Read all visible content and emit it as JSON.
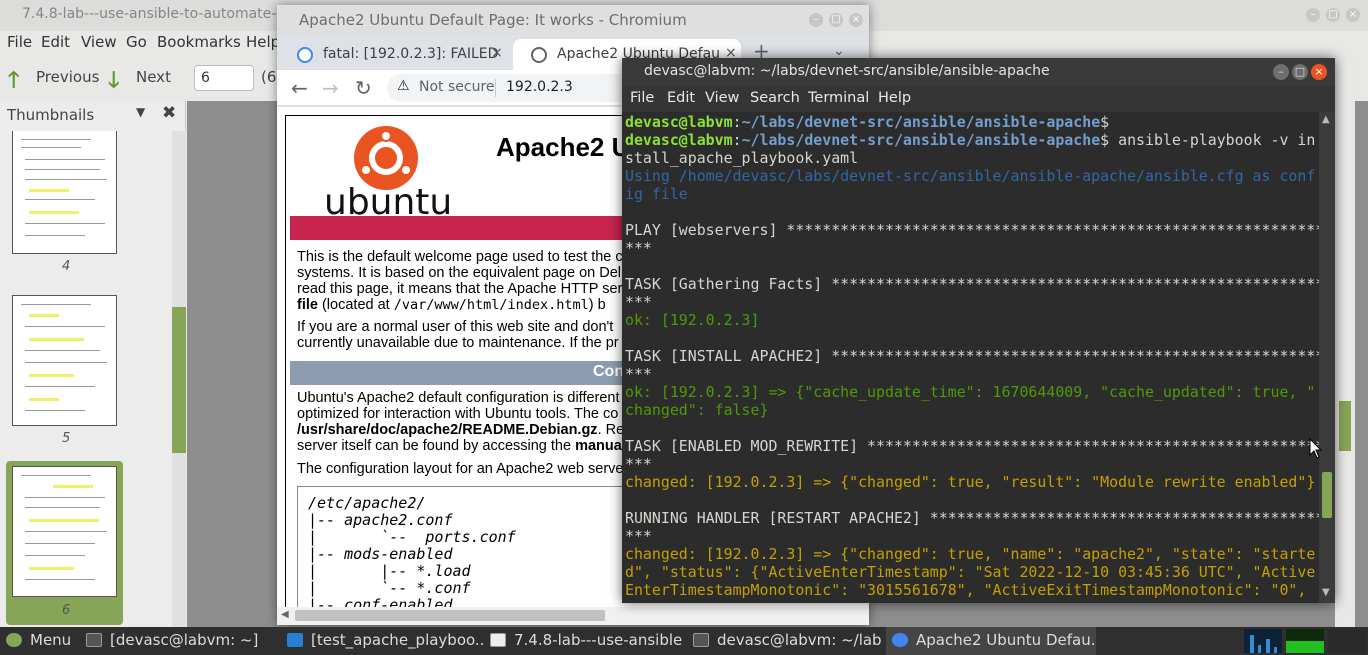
{
  "pdf_viewer": {
    "title": "7.4.8-lab---use-ansible-to-automate-in",
    "menu": [
      "File",
      "Edit",
      "View",
      "Go",
      "Bookmarks",
      "Help"
    ],
    "toolbar": {
      "previous": "Previous",
      "next": "Next",
      "page_value": "6",
      "page_total": "(6"
    },
    "sidebar": {
      "title": "Thumbnails",
      "page_labels": [
        "4",
        "5",
        "6"
      ]
    }
  },
  "browser": {
    "title": "Apache2 Ubuntu Default Page: It works - Chromium",
    "tabs": [
      {
        "label": "fatal: [192.0.2.3]: FAILED"
      },
      {
        "label": "Apache2 Ubuntu Defau"
      }
    ],
    "new_tab": "+",
    "address": {
      "security": "Not secure",
      "url": "192.0.2.3"
    },
    "page": {
      "heading": "Apache2 U",
      "logo_text": "ubuntu",
      "p1": [
        "This is the default welcome page used to test the c",
        "systems. It is based on the equivalent page on Del",
        "read this page, it means that the Apache HTTP ser",
        "file",
        " (located at ",
        "/var/www/html/index.html",
        ") b"
      ],
      "p2": [
        "If you are a normal user of this web site and don't",
        "currently unavailable due to maintenance. If the pr"
      ],
      "section_title": "Con",
      "p3": [
        "Ubuntu's Apache2 default configuration is different",
        "optimized for interaction with Ubuntu tools. The co",
        "/usr/share/doc/apache2/README.Debian.gz",
        ". Re",
        "server itself can be found by accessing the ",
        "manua"
      ],
      "p4": "The configuration layout for an Apache2 web serve",
      "code": [
        "/etc/apache2/",
        "|-- apache2.conf",
        "|       `--  ports.conf",
        "|-- mods-enabled",
        "|       |-- *.load",
        "|       `-- *.conf",
        "|-- conf-enabled"
      ]
    }
  },
  "terminal": {
    "title": "devasc@labvm: ~/labs/devnet-src/ansible/ansible-apache",
    "menu": [
      "File",
      "Edit",
      "View",
      "Search",
      "Terminal",
      "Help"
    ],
    "prompt_user": "devasc@labvm",
    "prompt_path": "~/labs/devnet-src/ansible/ansible-apache",
    "command": " ansible-playbook -v in",
    "lines": [
      "stall_apache_playbook.yaml",
      "Using /home/devasc/labs/devnet-src/ansible/ansible-apache/ansible.cfg as conf",
      "ig file",
      "",
      "PLAY [webservers] ************************************************************",
      "***",
      "",
      "TASK [Gathering Facts] *******************************************************",
      "***",
      "ok: [192.0.2.3]",
      "",
      "TASK [INSTALL APACHE2] *******************************************************",
      "***",
      "ok: [192.0.2.3] => {\"cache_update_time\": 1670644009, \"cache_updated\": true, \"",
      "changed\": false}",
      "",
      "TASK [ENABLED MOD_REWRITE] ***************************************************",
      "***",
      "changed: [192.0.2.3] => {\"changed\": true, \"result\": \"Module rewrite enabled\"}",
      "",
      "RUNNING HANDLER [RESTART APACHE2] ********************************************",
      "***",
      "changed: [192.0.2.3] => {\"changed\": true, \"name\": \"apache2\", \"state\": \"starte",
      "d\", \"status\": {\"ActiveEnterTimestamp\": \"Sat 2022-12-10 03:45:36 UTC\", \"Active",
      "EnterTimestampMonotonic\": \"3015561678\", \"ActiveExitTimestampMonotonic\": \"0\","
    ]
  },
  "taskbar": {
    "menu": "Menu",
    "items": [
      "[devasc@labvm: ~]",
      "[test_apache_playboo...",
      "7.4.8-lab---use-ansible-...",
      "devasc@labvm: ~/labs...",
      "Apache2 Ubuntu Defau..."
    ]
  },
  "colors": {
    "ubuntu_orange": "#e95420",
    "apache_banner_red": "#c7254e",
    "apache_section_grey": "#8e9cb2",
    "term_prompt_green": "#8ae234",
    "term_path_blue": "#729fcf",
    "term_ok_green": "#4e9a06",
    "term_changed_yellow": "#c4a000",
    "sidebar_selected": "#87a556"
  }
}
